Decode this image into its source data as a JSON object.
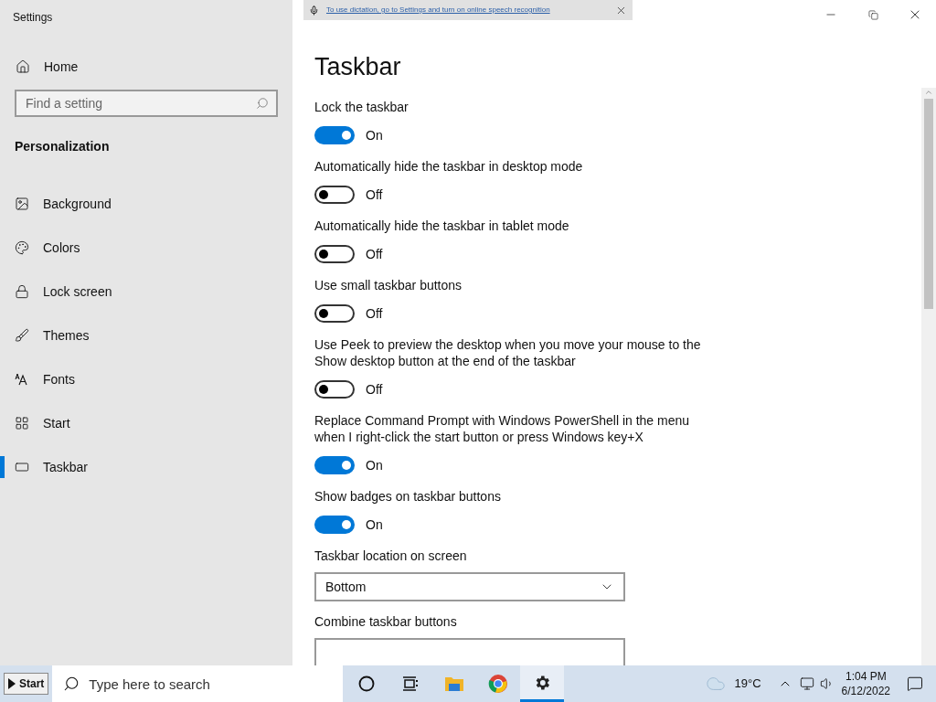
{
  "window": {
    "title": "Settings"
  },
  "dictation_bar": {
    "text": "To use dictation, go to Settings and turn on online speech recognition"
  },
  "sidebar": {
    "home": "Home",
    "search": {
      "placeholder": "Find a setting"
    },
    "section": "Personalization",
    "items": [
      {
        "label": "Background",
        "selected": false
      },
      {
        "label": "Colors",
        "selected": false
      },
      {
        "label": "Lock screen",
        "selected": false
      },
      {
        "label": "Themes",
        "selected": false
      },
      {
        "label": "Fonts",
        "selected": false
      },
      {
        "label": "Start",
        "selected": false
      },
      {
        "label": "Taskbar",
        "selected": true
      }
    ]
  },
  "page": {
    "title": "Taskbar",
    "settings": [
      {
        "kind": "toggle",
        "label": "Lock the taskbar",
        "on": true,
        "state": "On"
      },
      {
        "kind": "toggle",
        "label": "Automatically hide the taskbar in desktop mode",
        "on": false,
        "state": "Off"
      },
      {
        "kind": "toggle",
        "label": "Automatically hide the taskbar in tablet mode",
        "on": false,
        "state": "Off"
      },
      {
        "kind": "toggle",
        "label": "Use small taskbar buttons",
        "on": false,
        "state": "Off"
      },
      {
        "kind": "toggle",
        "label": "Use Peek to preview the desktop when you move your mouse to the Show desktop button at the end of the taskbar",
        "on": false,
        "state": "Off"
      },
      {
        "kind": "toggle",
        "label": "Replace Command Prompt with Windows PowerShell in the menu when I right-click the start button or press Windows key+X",
        "on": true,
        "state": "On"
      },
      {
        "kind": "toggle",
        "label": "Show badges on taskbar buttons",
        "on": true,
        "state": "On"
      },
      {
        "kind": "dropdown",
        "label": "Taskbar location on screen",
        "value": "Bottom"
      },
      {
        "kind": "dropdown",
        "label": "Combine taskbar buttons"
      }
    ]
  },
  "taskbar": {
    "start": "Start",
    "search": {
      "placeholder": "Type here to search"
    },
    "apps": [
      {
        "selected": false
      },
      {
        "selected": false
      },
      {
        "selected": false
      },
      {
        "selected": false
      },
      {
        "selected": true
      }
    ],
    "temperature": "19°C",
    "time": "1:04 PM",
    "date": "6/12/2022"
  }
}
